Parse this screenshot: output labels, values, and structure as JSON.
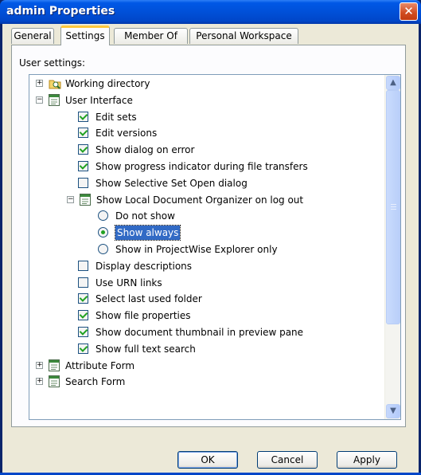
{
  "window": {
    "title": "admin Properties",
    "close_label": "✕"
  },
  "tabs": [
    {
      "label": "General"
    },
    {
      "label": "Settings"
    },
    {
      "label": "Member Of"
    },
    {
      "label": "Personal Workspace"
    }
  ],
  "panel": {
    "label": "User settings:"
  },
  "tree": {
    "rows": [
      {
        "label": "Working directory",
        "expander": "+",
        "icon": "folder-search-icon"
      },
      {
        "label": "User Interface",
        "expander": "−",
        "icon": "form-icon"
      },
      {
        "label": "Edit sets",
        "control": "checkbox",
        "checked": true
      },
      {
        "label": "Edit versions",
        "control": "checkbox",
        "checked": true
      },
      {
        "label": "Show dialog on error",
        "control": "checkbox",
        "checked": true
      },
      {
        "label": "Show progress indicator during file transfers",
        "control": "checkbox",
        "checked": true
      },
      {
        "label": "Show Selective Set Open dialog",
        "control": "checkbox",
        "checked": false
      },
      {
        "label": "Show Local Document Organizer on log out",
        "expander": "−",
        "icon": "form-icon"
      },
      {
        "label": "Do not show",
        "control": "radio",
        "checked": false
      },
      {
        "label": "Show always",
        "control": "radio",
        "checked": true,
        "selected": true
      },
      {
        "label": "Show in ProjectWise Explorer only",
        "control": "radio",
        "checked": false
      },
      {
        "label": "Display descriptions",
        "control": "checkbox",
        "checked": false
      },
      {
        "label": "Use URN links",
        "control": "checkbox",
        "checked": false
      },
      {
        "label": "Select last used folder",
        "control": "checkbox",
        "checked": true
      },
      {
        "label": "Show file properties",
        "control": "checkbox",
        "checked": true
      },
      {
        "label": "Show document thumbnail in preview pane",
        "control": "checkbox",
        "checked": true
      },
      {
        "label": "Show full text search",
        "control": "checkbox",
        "checked": true
      },
      {
        "label": "Attribute Form",
        "expander": "+",
        "icon": "form-icon"
      },
      {
        "label": "Search Form",
        "expander": "+",
        "icon": "form-icon"
      }
    ]
  },
  "buttons": {
    "ok": "OK",
    "cancel": "Cancel",
    "apply": "Apply"
  },
  "colors": {
    "title_bar": "#0054e3",
    "selection": "#316ac5",
    "check": "#21a121"
  }
}
